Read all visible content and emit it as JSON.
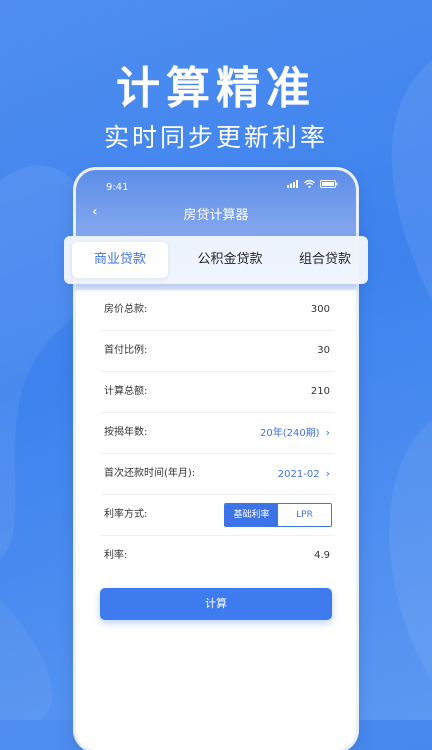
{
  "hero": {
    "title": "计算精准",
    "subtitle": "实时同步更新利率"
  },
  "status": {
    "time": "9:41"
  },
  "nav": {
    "title": "房贷计算器"
  },
  "tabs": [
    {
      "label": "商业贷款",
      "active": true
    },
    {
      "label": "公积金贷款",
      "active": false
    },
    {
      "label": "组合贷款",
      "active": false
    }
  ],
  "form": {
    "house_price": {
      "label": "房价总款:",
      "value": "300"
    },
    "down_payment": {
      "label": "首付比例:",
      "value": "30"
    },
    "total": {
      "label": "计算总额:",
      "value": "210"
    },
    "years": {
      "label": "按揭年数:",
      "value": "20年(240期)"
    },
    "first_payment": {
      "label": "首次还款时间(年月):",
      "value": "2021-02"
    },
    "rate_mode": {
      "label": "利率方式:",
      "options": [
        "基础利率",
        "LPR"
      ],
      "selected": "基础利率"
    },
    "rate": {
      "label": "利率:",
      "value": "4.9"
    }
  },
  "actions": {
    "calculate": "计算"
  },
  "colors": {
    "accent": "#3c73e6",
    "background": "#4a8af0"
  }
}
